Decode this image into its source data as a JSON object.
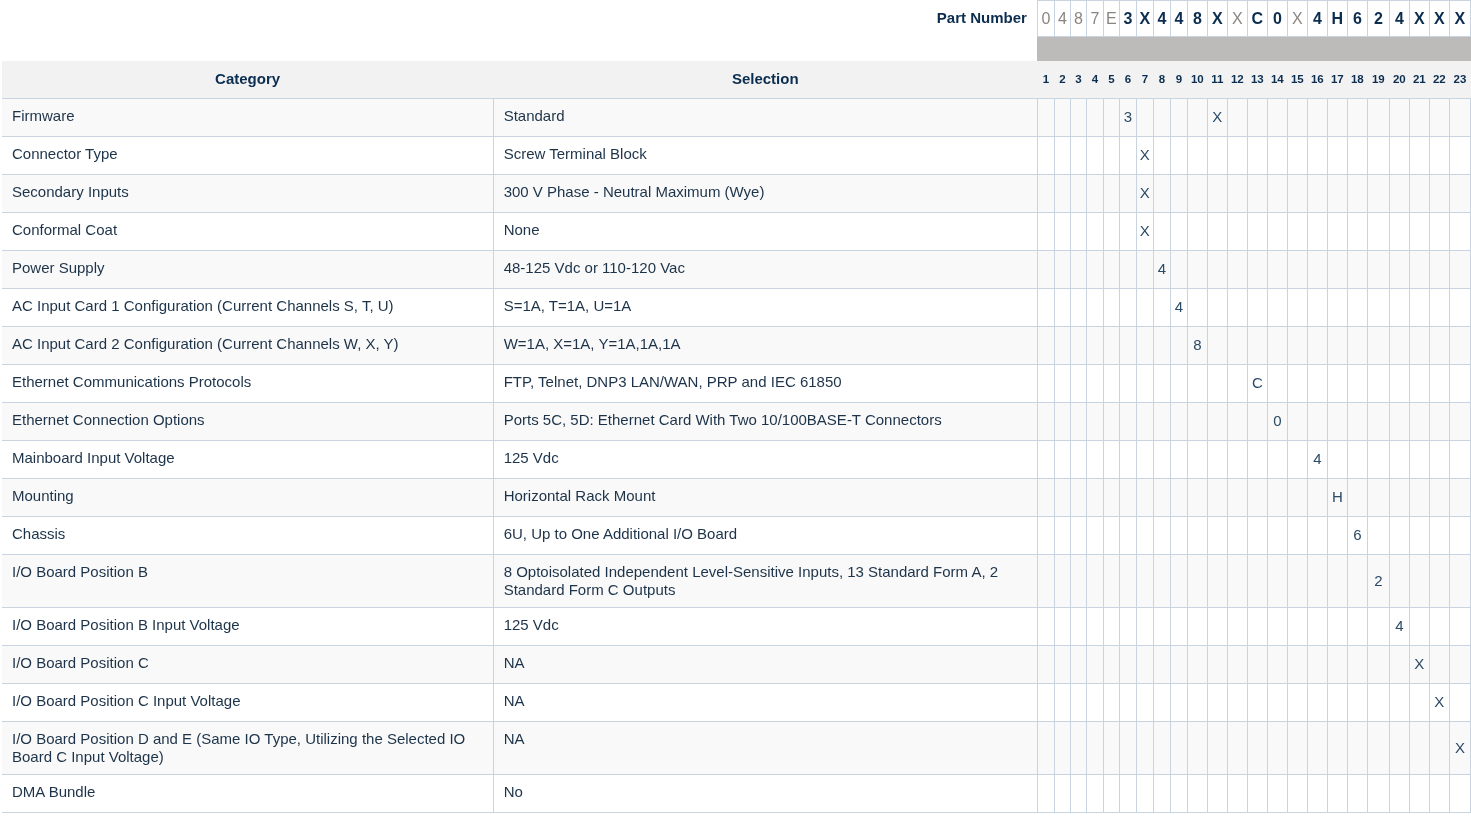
{
  "part_number": {
    "label": "Part Number",
    "characters": [
      {
        "char": "0",
        "kind": "fixed"
      },
      {
        "char": "4",
        "kind": "fixed"
      },
      {
        "char": "8",
        "kind": "fixed"
      },
      {
        "char": "7",
        "kind": "fixed"
      },
      {
        "char": "E",
        "kind": "fixed"
      },
      {
        "char": "3",
        "kind": "chosen"
      },
      {
        "char": "X",
        "kind": "chosen"
      },
      {
        "char": "4",
        "kind": "chosen"
      },
      {
        "char": "4",
        "kind": "chosen"
      },
      {
        "char": "8",
        "kind": "chosen"
      },
      {
        "char": "X",
        "kind": "chosen"
      },
      {
        "char": "X",
        "kind": "fixed"
      },
      {
        "char": "C",
        "kind": "chosen"
      },
      {
        "char": "0",
        "kind": "chosen"
      },
      {
        "char": "X",
        "kind": "fixed"
      },
      {
        "char": "4",
        "kind": "chosen"
      },
      {
        "char": "H",
        "kind": "chosen"
      },
      {
        "char": "6",
        "kind": "chosen"
      },
      {
        "char": "2",
        "kind": "chosen"
      },
      {
        "char": "4",
        "kind": "chosen"
      },
      {
        "char": "X",
        "kind": "chosen"
      },
      {
        "char": "X",
        "kind": "chosen"
      },
      {
        "char": "X",
        "kind": "chosen"
      }
    ]
  },
  "table": {
    "columns": [
      "Category",
      "Selection"
    ],
    "positions": [
      "1",
      "2",
      "3",
      "4",
      "5",
      "6",
      "7",
      "8",
      "9",
      "10",
      "11",
      "12",
      "13",
      "14",
      "15",
      "16",
      "17",
      "18",
      "19",
      "20",
      "21",
      "22",
      "23"
    ],
    "rows": [
      {
        "category": "Firmware",
        "selection": "Standard",
        "cells": [
          {},
          {},
          {},
          {},
          {},
          {
            "code": "3"
          },
          {},
          {},
          {},
          {},
          {
            "code": "X"
          },
          {},
          {},
          {},
          {},
          {},
          {},
          {},
          {},
          {},
          {},
          {},
          {}
        ]
      },
      {
        "category": "Connector Type",
        "selection": "Screw Terminal Block",
        "cells": [
          {},
          {},
          {},
          {},
          {},
          {},
          {
            "code": "X"
          },
          {},
          {},
          {},
          {},
          {},
          {},
          {},
          {},
          {},
          {},
          {},
          {},
          {},
          {},
          {},
          {}
        ]
      },
      {
        "category": "Secondary Inputs",
        "selection": "300 V Phase - Neutral Maximum (Wye)",
        "cells": [
          {},
          {},
          {},
          {},
          {},
          {},
          {
            "code": "X"
          },
          {},
          {},
          {},
          {},
          {},
          {},
          {},
          {},
          {},
          {},
          {},
          {},
          {},
          {},
          {},
          {}
        ]
      },
      {
        "category": "Conformal Coat",
        "selection": "None",
        "cells": [
          {},
          {},
          {},
          {},
          {},
          {},
          {
            "code": "X"
          },
          {},
          {},
          {},
          {},
          {},
          {},
          {},
          {},
          {},
          {},
          {},
          {},
          {},
          {},
          {},
          {}
        ]
      },
      {
        "category": "Power Supply",
        "selection": "48-125 Vdc or 110-120 Vac",
        "cells": [
          {},
          {},
          {},
          {},
          {},
          {},
          {},
          {
            "code": "4"
          },
          {},
          {},
          {},
          {},
          {},
          {},
          {},
          {},
          {},
          {},
          {},
          {},
          {},
          {},
          {}
        ]
      },
      {
        "category": "AC Input Card 1 Configuration (Current Channels S, T, U)",
        "selection": "S=1A, T=1A, U=1A",
        "cells": [
          {},
          {},
          {},
          {},
          {},
          {},
          {},
          {},
          {
            "code": "4"
          },
          {},
          {},
          {},
          {},
          {},
          {},
          {},
          {},
          {},
          {},
          {},
          {},
          {},
          {}
        ]
      },
      {
        "category": "AC Input Card 2 Configuration (Current Channels W, X, Y)",
        "selection": "W=1A, X=1A, Y=1A,1A,1A",
        "cells": [
          {},
          {},
          {},
          {},
          {},
          {},
          {},
          {},
          {},
          {
            "code": "8"
          },
          {},
          {},
          {},
          {},
          {},
          {},
          {},
          {},
          {},
          {},
          {},
          {},
          {}
        ]
      },
      {
        "category": "Ethernet Communications Protocols",
        "selection": "FTP, Telnet, DNP3 LAN/WAN, PRP and IEC 61850",
        "cells": [
          {},
          {},
          {},
          {},
          {},
          {},
          {},
          {},
          {},
          {},
          {},
          {},
          {
            "code": "C"
          },
          {},
          {},
          {},
          {},
          {},
          {},
          {},
          {},
          {},
          {}
        ]
      },
      {
        "category": "Ethernet Connection Options",
        "selection": "Ports 5C, 5D: Ethernet Card With Two 10/100BASE-T Connectors",
        "cells": [
          {},
          {},
          {},
          {},
          {},
          {},
          {},
          {},
          {},
          {},
          {},
          {},
          {},
          {
            "code": "0"
          },
          {},
          {},
          {},
          {},
          {},
          {},
          {},
          {},
          {}
        ]
      },
      {
        "category": "Mainboard Input Voltage",
        "selection": "125 Vdc",
        "cells": [
          {},
          {},
          {},
          {},
          {},
          {},
          {},
          {},
          {},
          {},
          {},
          {},
          {},
          {},
          {},
          {
            "code": "4"
          },
          {},
          {},
          {},
          {},
          {},
          {},
          {}
        ]
      },
      {
        "category": "Mounting",
        "selection": "Horizontal Rack Mount",
        "cells": [
          {},
          {},
          {},
          {},
          {},
          {},
          {},
          {},
          {},
          {},
          {},
          {},
          {},
          {},
          {},
          {},
          {
            "code": "H"
          },
          {},
          {},
          {},
          {},
          {},
          {}
        ]
      },
      {
        "category": "Chassis",
        "selection": "6U, Up to One Additional I/O Board",
        "cells": [
          {},
          {},
          {},
          {},
          {},
          {},
          {},
          {},
          {},
          {},
          {},
          {},
          {},
          {},
          {},
          {},
          {},
          {
            "code": "6"
          },
          {},
          {},
          {},
          {},
          {}
        ]
      },
      {
        "category": "I/O Board Position B",
        "selection": "8 Optoisolated Independent Level-Sensitive Inputs, 13 Standard Form A, 2 Standard Form C Outputs",
        "cells": [
          {},
          {},
          {},
          {},
          {},
          {},
          {},
          {},
          {},
          {},
          {},
          {},
          {},
          {},
          {},
          {},
          {},
          {},
          {
            "code": "2"
          },
          {},
          {},
          {},
          {}
        ]
      },
      {
        "category": "I/O Board Position B Input Voltage",
        "selection": "125 Vdc",
        "cells": [
          {},
          {},
          {},
          {},
          {},
          {},
          {},
          {},
          {},
          {},
          {},
          {},
          {},
          {},
          {},
          {},
          {},
          {},
          {},
          {
            "code": "4"
          },
          {},
          {},
          {}
        ]
      },
      {
        "category": "I/O Board Position C",
        "selection": "NA",
        "cells": [
          {},
          {},
          {},
          {},
          {},
          {},
          {},
          {},
          {},
          {},
          {},
          {},
          {},
          {},
          {},
          {},
          {},
          {},
          {},
          {},
          {
            "code": "X"
          },
          {},
          {}
        ]
      },
      {
        "category": "I/O Board Position C Input Voltage",
        "selection": "NA",
        "cells": [
          {},
          {},
          {},
          {},
          {},
          {},
          {},
          {},
          {},
          {},
          {},
          {},
          {},
          {},
          {},
          {},
          {},
          {},
          {},
          {},
          {},
          {
            "code": "X"
          },
          {}
        ]
      },
      {
        "category": "I/O Board Position D and E (Same IO Type, Utilizing the Selected IO Board C Input Voltage)",
        "selection": "NA",
        "cells": [
          {},
          {},
          {},
          {},
          {},
          {},
          {},
          {},
          {},
          {},
          {},
          {},
          {},
          {},
          {},
          {},
          {},
          {},
          {},
          {},
          {},
          {},
          {
            "code": "X"
          }
        ]
      },
      {
        "category": "DMA Bundle",
        "selection": "No",
        "cells": [
          {},
          {},
          {},
          {},
          {},
          {},
          {},
          {},
          {},
          {},
          {},
          {},
          {},
          {},
          {},
          {},
          {},
          {},
          {},
          {},
          {},
          {},
          {}
        ]
      }
    ]
  }
}
